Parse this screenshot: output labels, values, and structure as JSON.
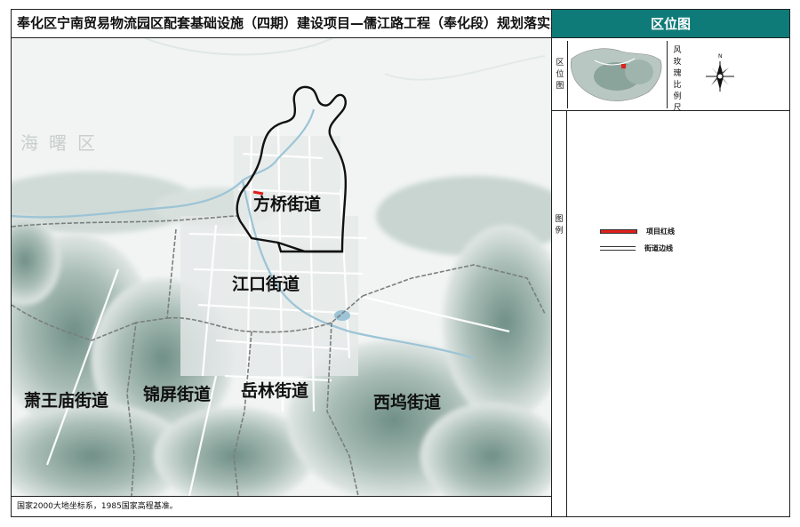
{
  "title": "奉化区宁南贸易物流园区配套基础设施（四期）建设项目—儒江路工程（奉化段）规划落实方案",
  "panel": {
    "header": "区位图",
    "location_label": "区位图",
    "rose_label": "风玫瑰比例尺",
    "legend_label": "图例",
    "legend": [
      {
        "label": "项目红线",
        "symbol": "red-line",
        "color": "#e0201a"
      },
      {
        "label": "街道边线",
        "symbol": "gray-double-line",
        "color": "#333333"
      }
    ]
  },
  "map": {
    "places": [
      {
        "name": "海曙区",
        "style": "faint"
      },
      {
        "name": "方桥街道",
        "style": "label"
      },
      {
        "name": "江口街道",
        "style": "label"
      },
      {
        "name": "萧王庙街道",
        "style": "label"
      },
      {
        "name": "锦屏街道",
        "style": "label"
      },
      {
        "name": "岳林街道",
        "style": "label"
      },
      {
        "name": "西坞街道",
        "style": "label"
      }
    ],
    "project_highlight_color": "#e0201a",
    "mountain_color": "#8fa8a0"
  },
  "footer": "国家2000大地坐标系，1985国家高程基准。"
}
